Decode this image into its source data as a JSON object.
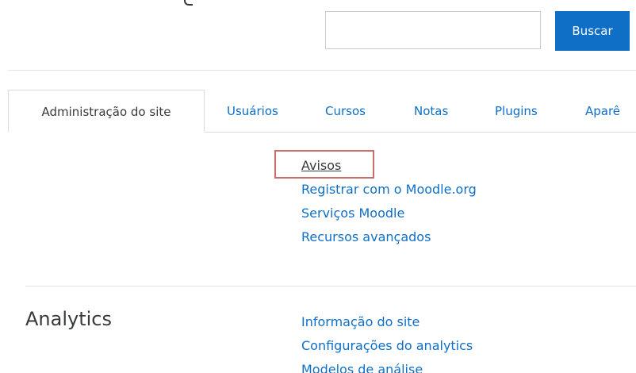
{
  "search": {
    "value": "",
    "placeholder": "",
    "button_label": "Buscar"
  },
  "tabs": [
    {
      "label": "Administração do site",
      "active": true
    },
    {
      "label": "Usuários",
      "active": false
    },
    {
      "label": "Cursos",
      "active": false
    },
    {
      "label": "Notas",
      "active": false
    },
    {
      "label": "Plugins",
      "active": false
    },
    {
      "label": "Aparê",
      "active": false
    }
  ],
  "general_links": [
    {
      "label": "Avisos",
      "highlighted": true
    },
    {
      "label": "Registrar com o Moodle.org"
    },
    {
      "label": "Serviços Moodle"
    },
    {
      "label": "Recursos avançados"
    }
  ],
  "analytics": {
    "heading": "Analytics",
    "links": [
      {
        "label": "Informação do site"
      },
      {
        "label": "Configurações do analytics"
      },
      {
        "label": "Modelos de análise"
      }
    ]
  },
  "colors": {
    "accent": "#0f6fc6",
    "highlight": "#cd6a6a",
    "text": "#373a3c"
  }
}
